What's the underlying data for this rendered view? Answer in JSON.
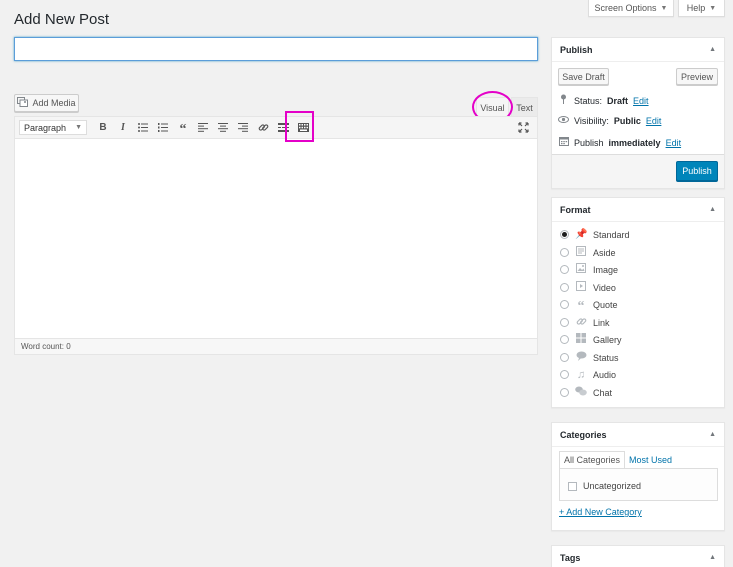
{
  "page": {
    "title": "Add New Post"
  },
  "top_buttons": {
    "screen_options": "Screen Options",
    "help": "Help"
  },
  "title_input": {
    "value": "",
    "placeholder": ""
  },
  "editor": {
    "add_media": "Add Media",
    "tab_visual": "Visual",
    "tab_text": "Text",
    "format_select": "Paragraph",
    "toolbar_icons": [
      "bold-icon",
      "italic-icon",
      "bulleted-list-icon",
      "numbered-list-icon",
      "blockquote-icon",
      "align-left-icon",
      "align-center-icon",
      "align-right-icon",
      "insert-link-icon",
      "read-more-icon",
      "toolbar-toggle-icon"
    ],
    "fullscreen_icon": "distraction-free-icon",
    "word_count": "Word count: 0"
  },
  "publish_box": {
    "title": "Publish",
    "save_draft": "Save Draft",
    "preview": "Preview",
    "status_label": "Status:",
    "status_value": "Draft",
    "visibility_label": "Visibility:",
    "visibility_value": "Public",
    "publish_label": "Publish",
    "publish_value": "immediately",
    "edit": "Edit",
    "publish_button": "Publish"
  },
  "format_box": {
    "title": "Format",
    "selected": "Standard",
    "options": [
      {
        "label": "Standard",
        "icon": "pin-icon"
      },
      {
        "label": "Aside",
        "icon": "aside-icon"
      },
      {
        "label": "Image",
        "icon": "image-icon"
      },
      {
        "label": "Video",
        "icon": "video-icon"
      },
      {
        "label": "Quote",
        "icon": "quote-icon"
      },
      {
        "label": "Link",
        "icon": "link-icon"
      },
      {
        "label": "Gallery",
        "icon": "gallery-icon"
      },
      {
        "label": "Status",
        "icon": "status-icon"
      },
      {
        "label": "Audio",
        "icon": "audio-icon"
      },
      {
        "label": "Chat",
        "icon": "chat-icon"
      }
    ]
  },
  "categories_box": {
    "title": "Categories",
    "tab_all": "All Categories",
    "tab_most_used": "Most Used",
    "items": [
      {
        "label": "Uncategorized",
        "checked": false
      }
    ],
    "add_new": "+ Add New Category"
  },
  "tags_box": {
    "title": "Tags"
  },
  "colors": {
    "accent": "#0073aa",
    "primary_button": "#0085ba",
    "highlight": "#e400c8"
  }
}
